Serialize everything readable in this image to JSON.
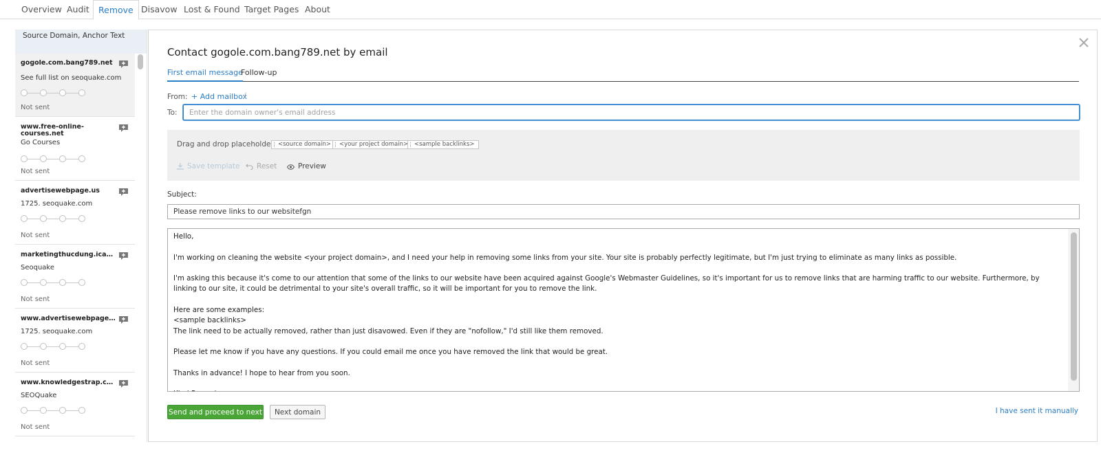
{
  "nav": {
    "tabs": [
      "Overview",
      "Audit",
      "Remove",
      "Disavow",
      "Lost & Found",
      "Target Pages",
      "About"
    ],
    "active": "Remove"
  },
  "list": {
    "header": "Source Domain, Anchor Text",
    "items": [
      {
        "domain": "gogole.com.bang789.net",
        "anchor": "See full list on seoquake.com",
        "status": "Not sent"
      },
      {
        "domain": "www.free-online-courses.net",
        "anchor": "Go Courses",
        "status": "Not sent"
      },
      {
        "domain": "advertisewebpage.us",
        "anchor": "1725. seoquake.com",
        "status": "Not sent"
      },
      {
        "domain": "marketingthucdung.icand...",
        "anchor": "Seoquake",
        "status": "Not sent"
      },
      {
        "domain": "www.advertisewebpage.us",
        "anchor": "1725. seoquake.com",
        "status": "Not sent"
      },
      {
        "domain": "www.knowledgestrap.com",
        "anchor": "SEOQuake",
        "status": "Not sent"
      }
    ]
  },
  "modal": {
    "title": "Contact gogole.com.bang789.net by email",
    "tabs": [
      "First email message",
      "Follow-up"
    ],
    "from_label": "From:",
    "add_mailbox": "Add mailbox",
    "to_label": "To:",
    "to_placeholder": "Enter the domain owner's email address",
    "placeholders_label": "Drag and drop placeholders:",
    "placeholders": [
      "<source domain>",
      "<your project domain>",
      "<sample backlinks>"
    ],
    "save_template": "Save template",
    "reset": "Reset",
    "preview": "Preview",
    "subject_label": "Subject:",
    "subject_value": "Please remove links to our websitefgn",
    "body": "Hello,\n\nI'm working on cleaning the website <your project domain>, and I need your help in removing some links from your site. Your site is probably perfectly legitimate, but I'm just trying to eliminate as many links as possible.\n\nI'm asking this because it's come to our attention that some of the links to our website have been acquired against Google's Webmaster Guidelines, so it's important for us to remove links that are harming traffic to our website. Furthermore, by linking to our site, it could be detrimental to your site's overall traffic, so it will be important for you to remove the link.\n\nHere are some examples:\n<sample backlinks>\nThe link need to be actually removed, rather than just disavowed. Even if they are \"nofollow,\" I'd still like them removed.\n\nPlease let me know if you have any questions. If you could email me once you have removed the link that would be great.\n\nThanks in advance! I hope to hear from you soon.\n\nKind Regards",
    "send_button": "Send and proceed to next",
    "next_button": "Next domain",
    "manual_link": "I have sent it manually"
  }
}
